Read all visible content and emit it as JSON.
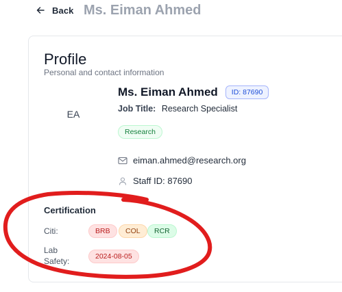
{
  "header": {
    "back_label": "Back",
    "title": "Ms. Eiman Ahmed"
  },
  "profile": {
    "heading": "Profile",
    "subheading": "Personal and contact information",
    "avatar_initials": "EA",
    "name": "Ms. Eiman Ahmed",
    "id_badge": "ID: 87690",
    "job_title_label": "Job Title:",
    "job_title_value": "Research Specialist",
    "department_badge": "Research",
    "email": "eiman.ahmed@research.org",
    "staff_id": "Staff ID: 87690"
  },
  "certification": {
    "heading": "Certification",
    "citi_label": "Citi:",
    "citi_items": [
      "BRB",
      "COL",
      "RCR"
    ],
    "lab_safety_label": "Lab Safety:",
    "lab_safety_date": "2024-08-05"
  },
  "colors": {
    "annotation": "#e11d1d",
    "id_badge_text": "#1d4ed8",
    "department_badge_text": "#15803d",
    "chip_red": "#b91c1c",
    "chip_orange": "#92400e",
    "chip_green": "#166534"
  },
  "icons": {
    "back": "arrow-left-icon",
    "email": "mail-icon",
    "staff": "user-icon"
  }
}
